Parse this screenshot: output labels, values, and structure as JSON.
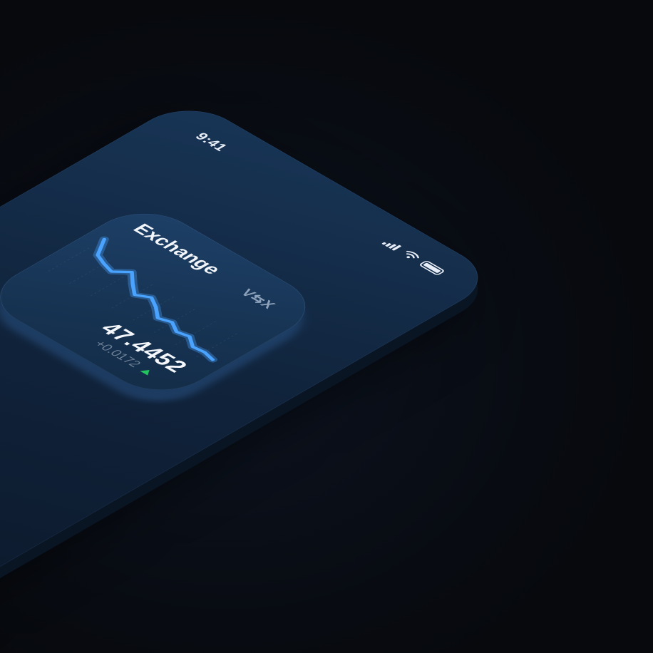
{
  "status_bar": {
    "time": "9:41",
    "icons": [
      "signal-icon",
      "wifi-icon",
      "battery-icon"
    ]
  },
  "widget": {
    "title": "Exchange",
    "pair": "V⇆X",
    "price": "47.4452",
    "change": "+0.0172",
    "trend_icon": "up-arrow-icon",
    "accent_color": "#4aa3ff",
    "up_color": "#22c55e"
  },
  "chart_data": {
    "type": "line",
    "x": [
      0,
      1,
      2,
      3,
      4,
      5,
      6,
      7,
      8,
      9,
      10,
      11,
      12,
      13,
      14,
      15
    ],
    "series": [
      {
        "values": [
          0.9,
          0.62,
          0.55,
          0.5,
          0.66,
          0.5,
          0.36,
          0.46,
          0.36,
          0.22,
          0.28,
          0.18,
          0.22,
          0.1,
          0.12,
          0.08
        ]
      }
    ],
    "ylim": [
      0,
      1
    ],
    "grid": true
  }
}
